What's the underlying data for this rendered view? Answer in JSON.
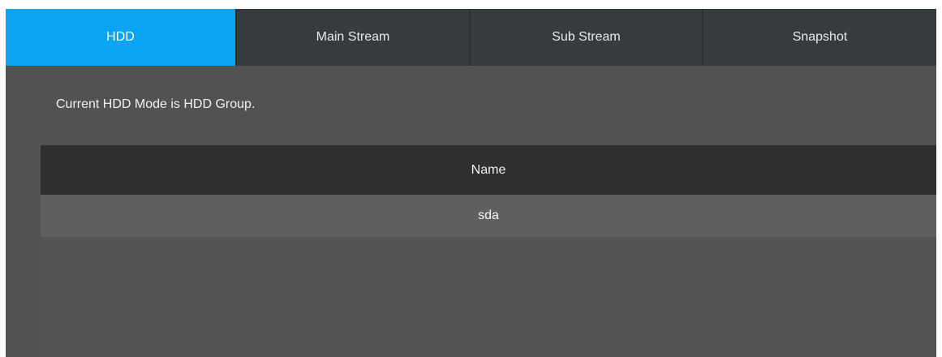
{
  "tabs": [
    {
      "label": "HDD",
      "active": true
    },
    {
      "label": "Main Stream",
      "active": false
    },
    {
      "label": "Sub Stream",
      "active": false
    },
    {
      "label": "Snapshot",
      "active": false
    }
  ],
  "main": {
    "mode_text": "Current HDD Mode is HDD Group."
  },
  "table": {
    "header": "Name",
    "rows": [
      "sda"
    ]
  },
  "colors": {
    "accent": "#0aa4f5",
    "panel_bg": "#525252",
    "tab_bg": "#353b3f",
    "table_header_bg": "#2f2f2f",
    "table_row_bg": "#5f5f5f"
  }
}
